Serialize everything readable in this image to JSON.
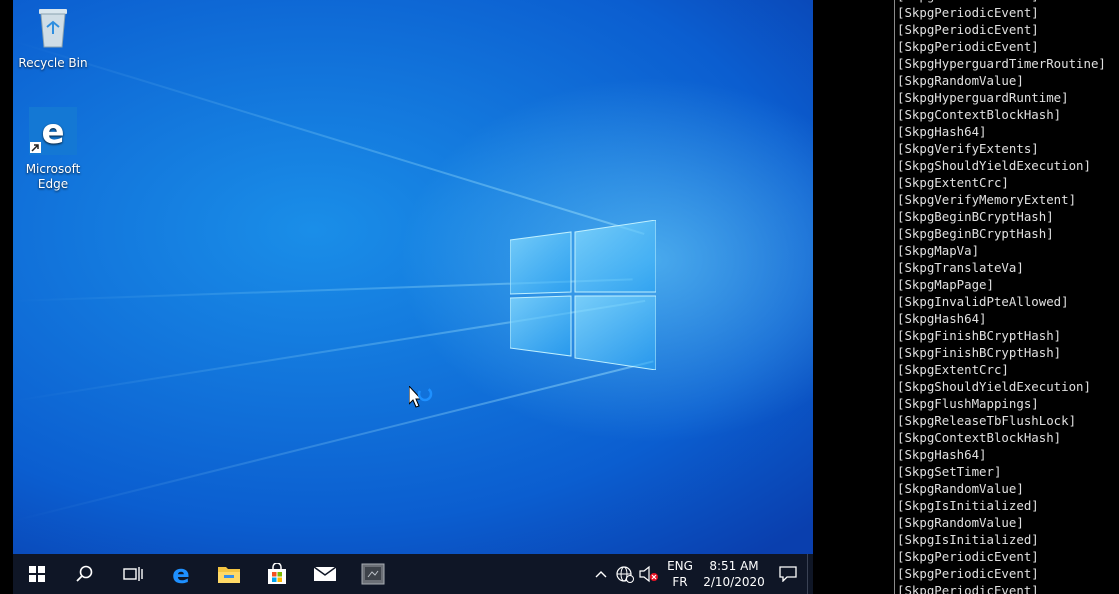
{
  "desktop": {
    "icons": [
      {
        "label": "Recycle Bin",
        "icon": "recycle-bin-icon"
      },
      {
        "label": "Microsoft Edge",
        "icon": "edge-icon"
      }
    ]
  },
  "taskbar": {
    "buttons": [
      {
        "icon": "windows-start-icon"
      },
      {
        "icon": "search-icon"
      },
      {
        "icon": "task-view-icon"
      },
      {
        "icon": "edge-icon"
      },
      {
        "icon": "file-explorer-icon"
      },
      {
        "icon": "store-icon"
      },
      {
        "icon": "mail-icon"
      },
      {
        "icon": "app-window-icon"
      }
    ],
    "tray": {
      "language_top": "ENG",
      "language_bottom": "FR",
      "time": "8:51 AM",
      "date": "2/10/2020"
    }
  },
  "console": {
    "lines": [
      "[SkpgPeriodicEvent]",
      "[SkpgPeriodicEvent]",
      "[SkpgPeriodicEvent]",
      "[SkpgPeriodicEvent]",
      "[SkpgHyperguardTimerRoutine]",
      "[SkpgRandomValue]",
      "[SkpgHyperguardRuntime]",
      "[SkpgContextBlockHash]",
      "[SkpgHash64]",
      "[SkpgVerifyExtents]",
      "[SkpgShouldYieldExecution]",
      "[SkpgExtentCrc]",
      "[SkpgVerifyMemoryExtent]",
      "[SkpgBeginBCryptHash]",
      "[SkpgBeginBCryptHash]",
      "[SkpgMapVa]",
      "[SkpgTranslateVa]",
      "[SkpgMapPage]",
      "[SkpgInvalidPteAllowed]",
      "[SkpgHash64]",
      "[SkpgFinishBCryptHash]",
      "[SkpgFinishBCryptHash]",
      "[SkpgExtentCrc]",
      "[SkpgShouldYieldExecution]",
      "[SkpgFlushMappings]",
      "[SkpgReleaseTbFlushLock]",
      "[SkpgContextBlockHash]",
      "[SkpgHash64]",
      "[SkpgSetTimer]",
      "[SkpgRandomValue]",
      "[SkpgIsInitialized]",
      "[SkpgRandomValue]",
      "[SkpgIsInitialized]",
      "[SkpgPeriodicEvent]",
      "[SkpgPeriodicEvent]",
      "[SkpgPeriodicEvent]"
    ]
  }
}
